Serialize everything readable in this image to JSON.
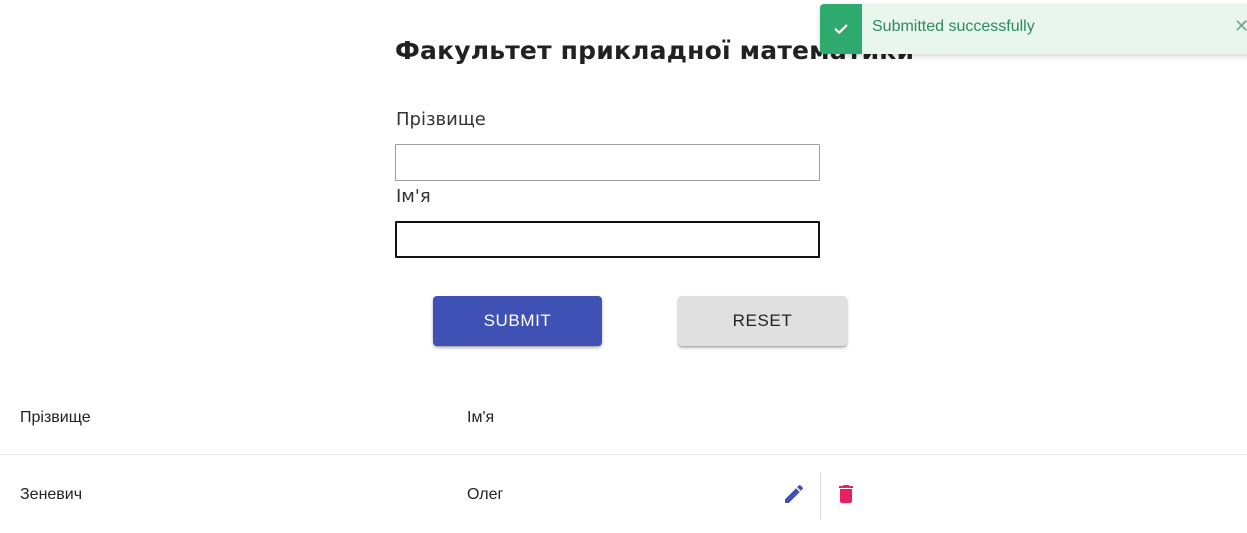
{
  "form": {
    "title": "Факультет прикладної математики",
    "surname_label": "Прізвище",
    "surname_value": "",
    "name_label": "Ім'я",
    "name_value": "",
    "submit_label": "SUBMIT",
    "reset_label": "RESET"
  },
  "table": {
    "headers": [
      "Прізвище",
      "Ім'я"
    ],
    "rows": [
      {
        "surname": "Зеневич",
        "name": "Олег",
        "edit_icon": "pencil-icon",
        "delete_icon": "trash-icon"
      }
    ]
  },
  "toast": {
    "message": "Submitted successfully",
    "icon": "check-icon",
    "close_icon": "close-icon"
  },
  "colors": {
    "primary": "#3f51b5",
    "reset_button": "#e0e0e0",
    "delete": "#e91e63",
    "toast_background": "#e8f6ee",
    "toast_accent": "#2eaa6e"
  }
}
